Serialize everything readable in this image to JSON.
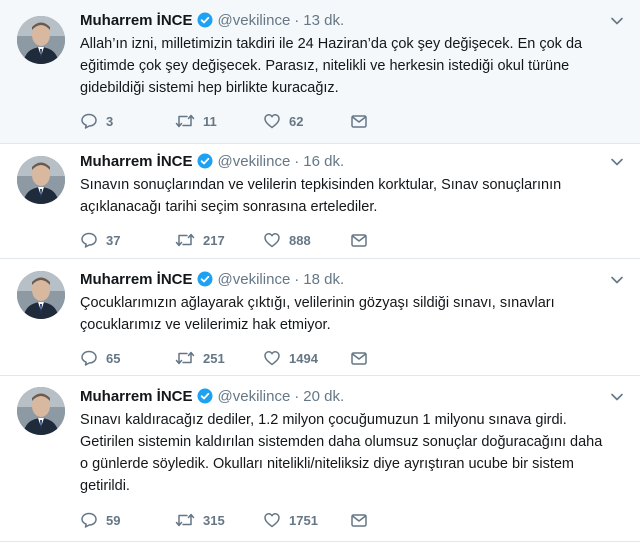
{
  "colors": {
    "verified": "#1da1f2",
    "secondary_text": "#657786",
    "highlight_bg": "#f5f8fa"
  },
  "icons": {
    "verified": "verified-badge-icon",
    "caret": "chevron-down-icon",
    "reply": "reply-icon",
    "retweet": "retweet-icon",
    "like": "heart-icon",
    "dm": "envelope-icon"
  },
  "tweets": [
    {
      "name": "Muharrem İNCE",
      "handle": "@vekilince",
      "separator": "·",
      "time": "13 dk.",
      "lines": [
        "Allah’ın izni, milletimizin takdiri ile 24 Haziran’da çok şey değişecek. En çok da",
        "eğitimde çok şey değişecek. Parasız, nitelikli ve herkesin istediği okul türüne",
        "gidebildiği sistemi hep birlikte kuracağız."
      ],
      "replies": "3",
      "retweets": "11",
      "likes": "62"
    },
    {
      "name": "Muharrem İNCE",
      "handle": "@vekilince",
      "separator": "·",
      "time": "16 dk.",
      "lines": [
        "Sınavın sonuçlarından ve velilerin tepkisinden korktular, Sınav sonuçlarının",
        "açıklanacağı tarihi seçim sonrasına ertelediler."
      ],
      "replies": "37",
      "retweets": "217",
      "likes": "888"
    },
    {
      "name": "Muharrem İNCE",
      "handle": "@vekilince",
      "separator": "·",
      "time": "18 dk.",
      "lines": [
        "Çocuklarımızın ağlayarak çıktığı, velilerinin gözyaşı sildiği sınavı, sınavları",
        "çocuklarımız ve velilerimiz hak etmiyor."
      ],
      "replies": "65",
      "retweets": "251",
      "likes": "1494"
    },
    {
      "name": "Muharrem İNCE",
      "handle": "@vekilince",
      "separator": "·",
      "time": "20 dk.",
      "lines": [
        "Sınavı kaldıracağız dediler, 1.2 milyon çocuğumuzun 1 milyonu sınava girdi.",
        "Getirilen sistemin kaldırılan sistemden daha olumsuz sonuçlar doğuracağını daha",
        "o günlerde söyledik. Okulları nitelikli/niteliksiz diye ayrıştıran ucube bir sistem",
        "getirildi."
      ],
      "replies": "59",
      "retweets": "315",
      "likes": "1751"
    }
  ]
}
